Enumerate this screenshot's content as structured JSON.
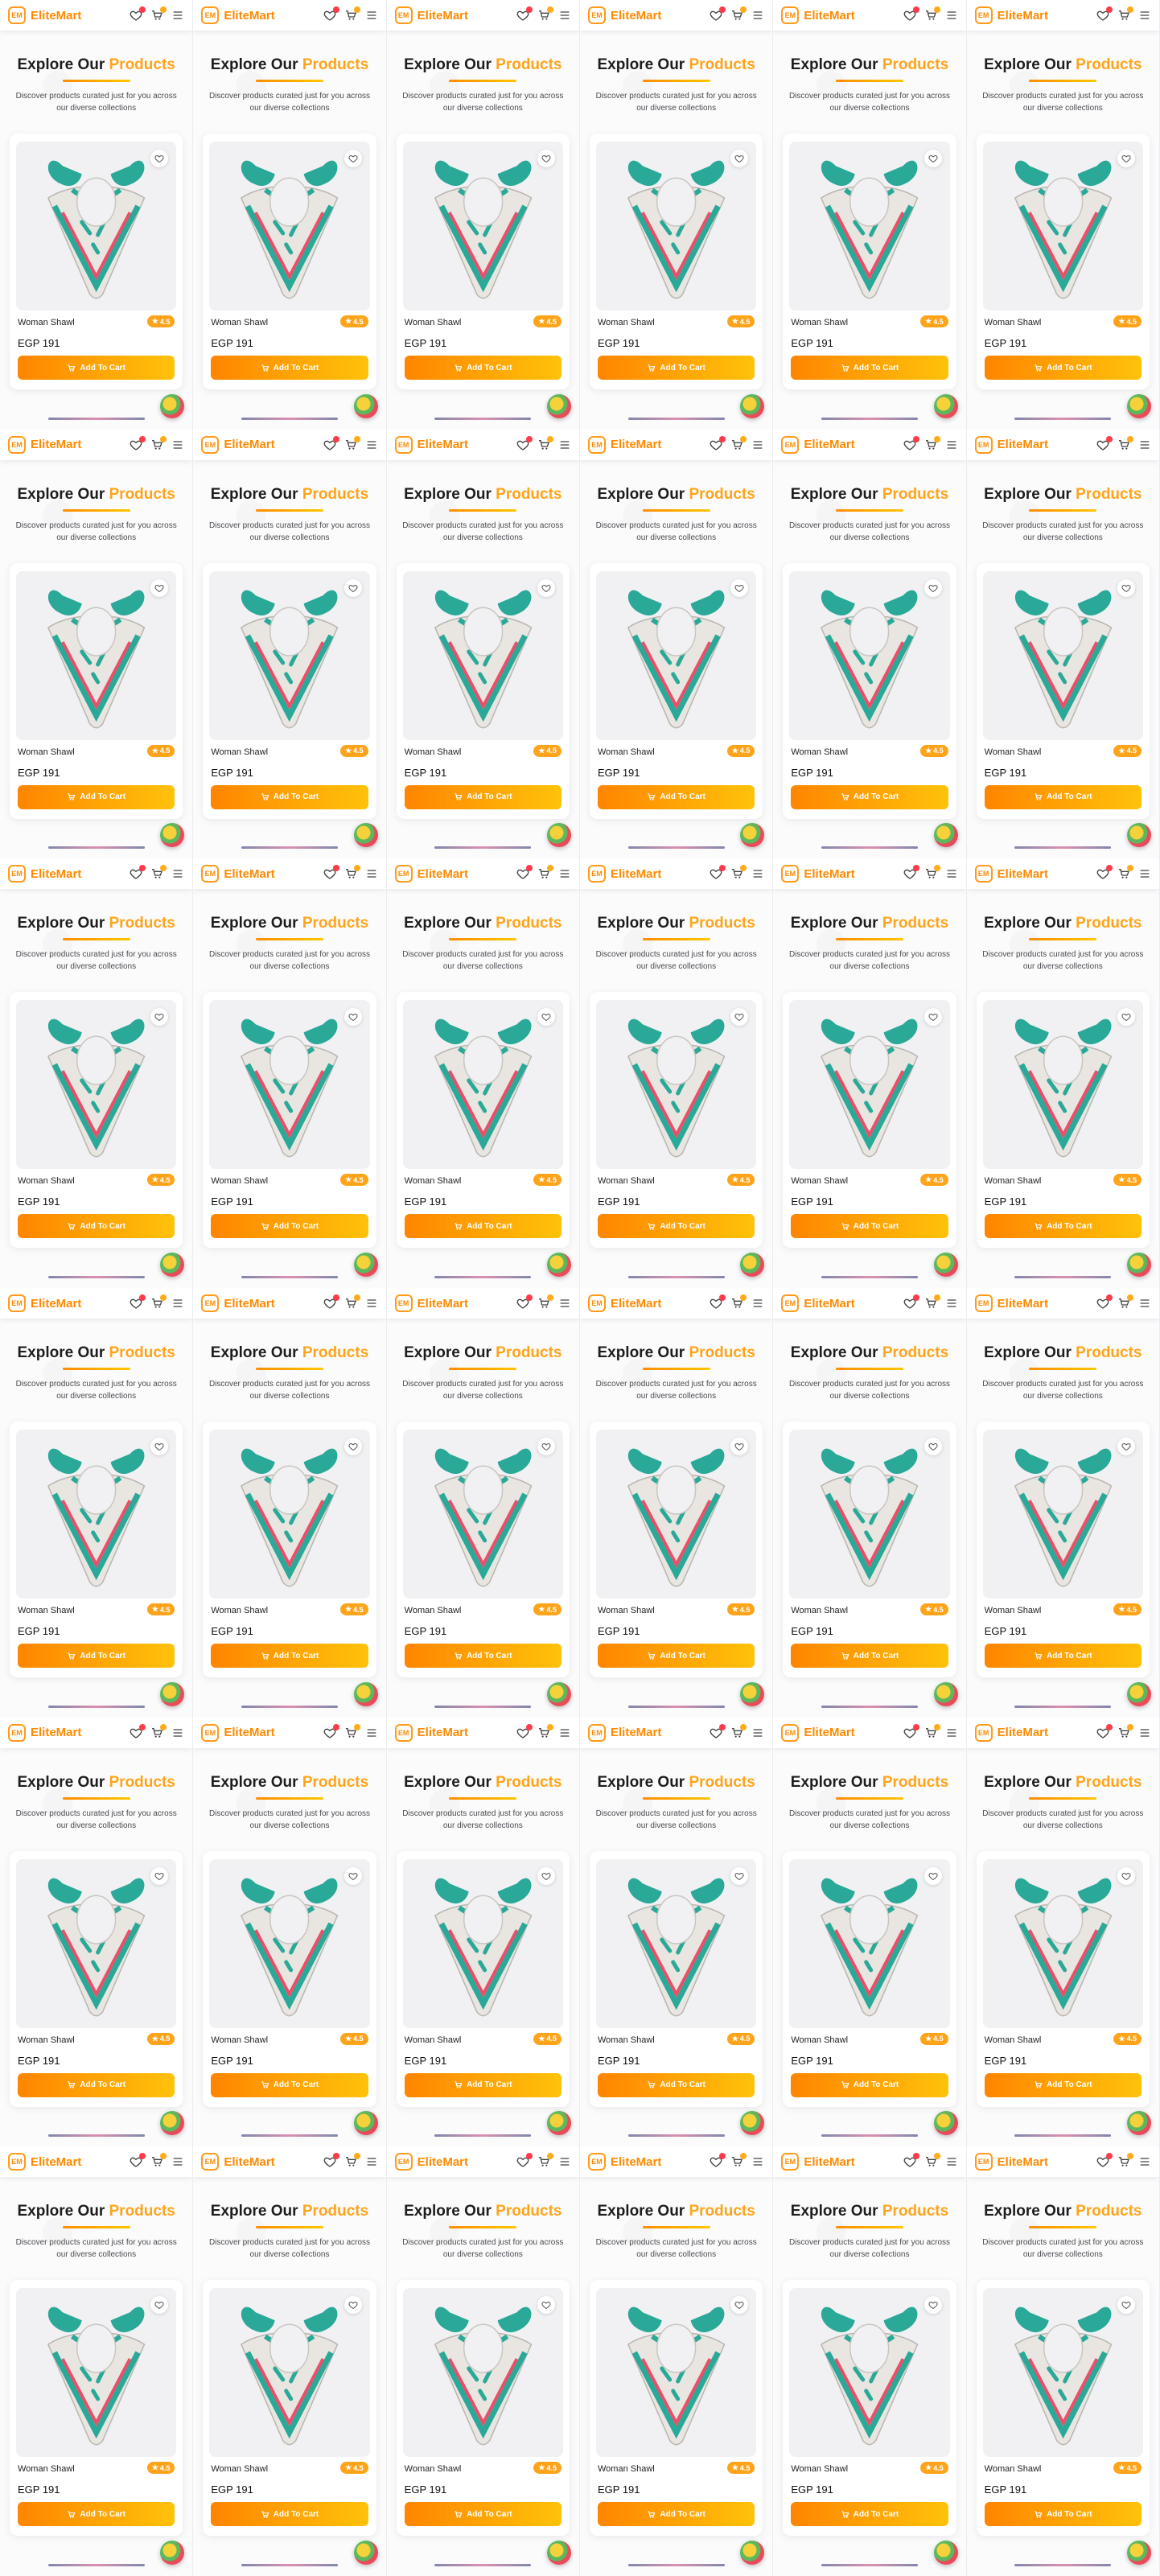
{
  "brand": {
    "badge": "EM",
    "name": "EliteMart"
  },
  "hero": {
    "title_lead": "Explore Our",
    "title_accent": "Products",
    "subtitle": "Discover products curated just for you across our diverse collections"
  },
  "product": {
    "name": "Woman Shawl",
    "price": "EGP 191",
    "rating": "4.5",
    "add_to_cart_label": "Add To Cart"
  },
  "icons": {
    "wishlist": "heart-icon",
    "cart": "cart-icon",
    "menu": "menu-icon",
    "card_wishlist": "heart-outline-icon",
    "rating": "star-icon",
    "button": "cart-icon"
  },
  "colors": {
    "accent": "#ffa41a",
    "brand": "#ff8a00",
    "button_start": "#ff8500",
    "button_end": "#ffc20a",
    "badge_red": "#ff3b4a"
  },
  "grid": {
    "columns": 6,
    "rows": 6
  }
}
